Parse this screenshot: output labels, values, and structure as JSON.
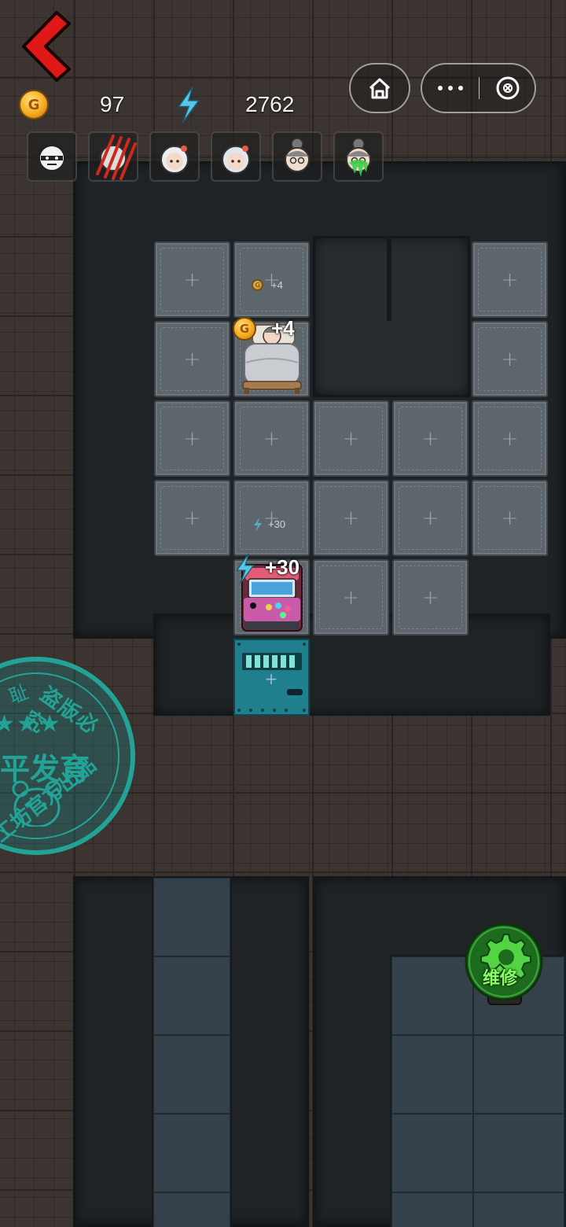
{
  "hud": {
    "coins": "97",
    "energy": "2762",
    "coin_symbol": "G"
  },
  "mini_program": {
    "home_icon": "home-icon",
    "more_icon": "more-dots-icon",
    "close_icon": "close-circle-icon"
  },
  "portraits": [
    {
      "name": "portrait-hunter"
    },
    {
      "name": "portrait-claw-marks"
    },
    {
      "name": "portrait-white-hair-girl-1"
    },
    {
      "name": "portrait-white-hair-girl-2"
    },
    {
      "name": "portrait-granny"
    },
    {
      "name": "portrait-granny-slimed"
    }
  ],
  "room": {
    "bed_gain_faint": "+4",
    "bed_gain": "+4",
    "arcade_gain_faint": "+30",
    "arcade_gain": "+30"
  },
  "watermark": {
    "line_top_left": "耻",
    "line_top_right": "盗版必究",
    "line_middle": "平发育",
    "line_bottom": "工坊官方出品"
  },
  "repair": {
    "label": "维修"
  },
  "colors": {
    "back_arrow": "#e01818",
    "energy": "#56c7e6",
    "watermark": "#1fb7a8",
    "repair_bg": "#1d6b1d",
    "repair_gear": "#58e04a",
    "door": "#1f7f8c"
  }
}
